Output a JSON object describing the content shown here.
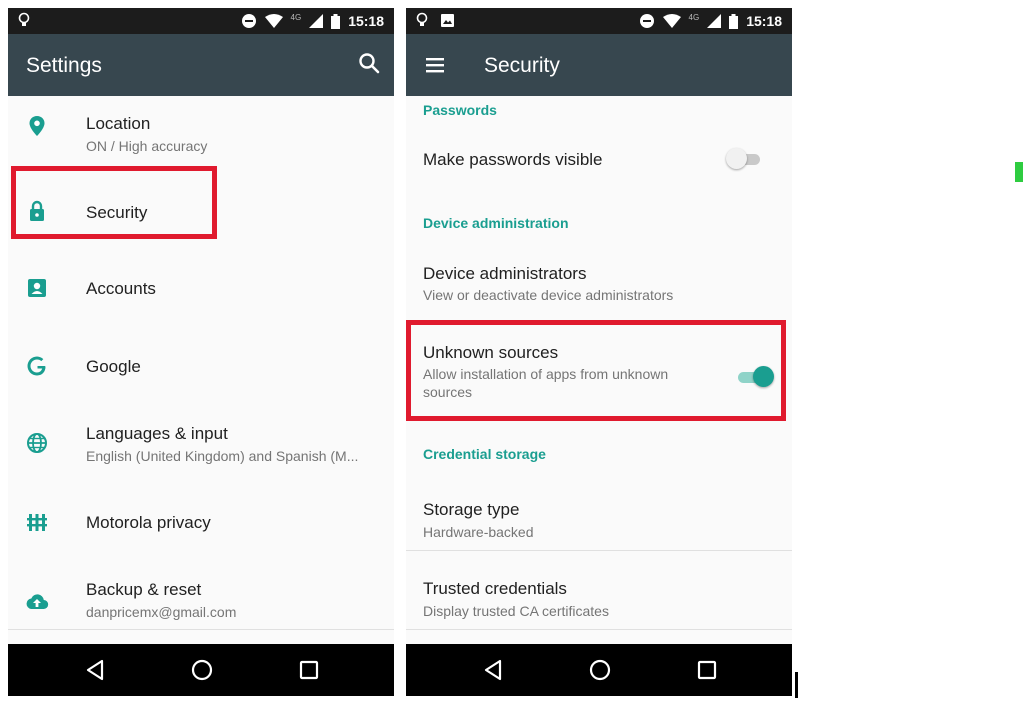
{
  "status_bar": {
    "time": "15:18",
    "network": "4G"
  },
  "settings_screen": {
    "title": "Settings",
    "items": [
      {
        "title": "Location",
        "subtitle": "ON / High accuracy",
        "icon": "location-pin-icon"
      },
      {
        "title": "Security",
        "subtitle": "",
        "icon": "lock-icon"
      },
      {
        "title": "Accounts",
        "subtitle": "",
        "icon": "account-box-icon"
      },
      {
        "title": "Google",
        "subtitle": "",
        "icon": "google-g-icon"
      },
      {
        "title": "Languages & input",
        "subtitle": "English (United Kingdom) and Spanish (M...",
        "icon": "globe-icon"
      },
      {
        "title": "Motorola privacy",
        "subtitle": "",
        "icon": "privacy-fence-icon"
      },
      {
        "title": "Backup & reset",
        "subtitle": "danpricemx@gmail.com",
        "icon": "cloud-upload-icon"
      }
    ]
  },
  "security_screen": {
    "title": "Security",
    "passwords_header": "Passwords",
    "make_passwords_visible": {
      "title": "Make passwords visible",
      "enabled": false
    },
    "device_admin_header": "Device administration",
    "device_administrators": {
      "title": "Device administrators",
      "subtitle": "View or deactivate device administrators"
    },
    "unknown_sources": {
      "title": "Unknown sources",
      "subtitle_line1": "Allow installation of apps from unknown",
      "subtitle_line2": "sources",
      "enabled": true
    },
    "credential_storage_header": "Credential storage",
    "storage_type": {
      "title": "Storage type",
      "subtitle": "Hardware-backed"
    },
    "trusted_credentials": {
      "title": "Trusted credentials",
      "subtitle": "Display trusted CA certificates"
    }
  },
  "colors": {
    "accent": "#1a9e90",
    "app_bar": "#37474f",
    "status_bar": "#1c1c1c",
    "highlight": "#e01a2e"
  }
}
